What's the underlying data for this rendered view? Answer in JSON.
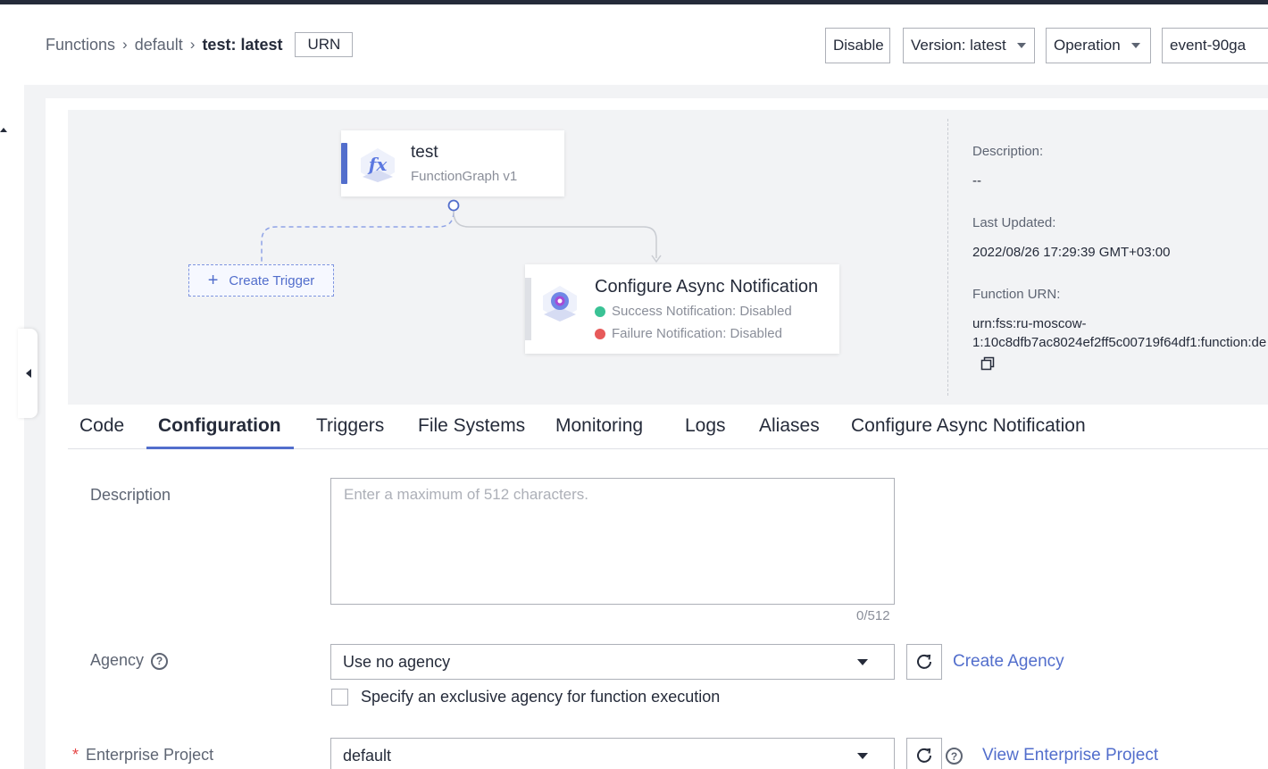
{
  "breadcrumb": {
    "items": [
      "Functions",
      "default"
    ],
    "separator": "›",
    "current": "test: latest",
    "urn_button": "URN"
  },
  "header_actions": {
    "disable": "Disable",
    "version": "Version: latest",
    "operation": "Operation",
    "event": "event-90ga"
  },
  "flow": {
    "function_card": {
      "title": "test",
      "subtitle": "FunctionGraph v1",
      "icon": "function-fx-icon"
    },
    "create_trigger": "Create Trigger",
    "async_card": {
      "title": "Configure Async Notification",
      "success": "Success Notification: Disabled",
      "failure": "Failure Notification: Disabled",
      "success_color": "#3ac295",
      "failure_color": "#e75a5a"
    }
  },
  "details": {
    "description_label": "Description:",
    "description_value": "--",
    "updated_label": "Last Updated:",
    "updated_value": "2022/08/26 17:29:39 GMT+03:00",
    "urn_label": "Function URN:",
    "urn_line1": "urn:fss:ru-moscow-",
    "urn_line2": "1:10c8dfb7ac8024ef2ff5c00719f64df1:function:de"
  },
  "tabs": [
    "Code",
    "Configuration",
    "Triggers",
    "File Systems",
    "Monitoring",
    "Logs",
    "Aliases",
    "Configure Async Notification"
  ],
  "active_tab": "Configuration",
  "form": {
    "description_label": "Description",
    "description_placeholder": "Enter a maximum of 512 characters.",
    "description_counter": "0/512",
    "agency_label": "Agency",
    "agency_value": "Use no agency",
    "create_agency": "Create Agency",
    "exclusive_agency": "Specify an exclusive agency for function execution",
    "enterprise_required": "*",
    "enterprise_label": "Enterprise Project",
    "enterprise_value": "default",
    "view_enterprise": "View Enterprise Project"
  },
  "colors": {
    "accent": "#526ecc",
    "text": "#252b3a",
    "muted": "#5e6573"
  }
}
